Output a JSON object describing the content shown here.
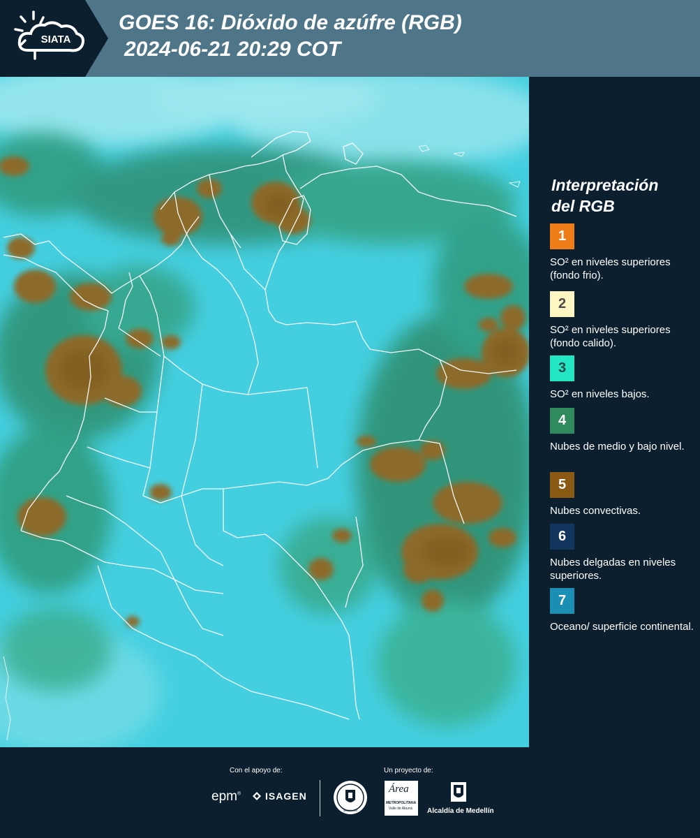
{
  "header": {
    "logo_text": "SIATA",
    "title_line1": "GOES 16: Dióxido de azúfre (RGB)",
    "title_line2": "2024-06-21 20:29 COT"
  },
  "map": {
    "base_color": "#3ec8dc",
    "convective_color": "#8a6a2a",
    "low_cloud_color": "#2f8a66",
    "border_color": "#ffffff"
  },
  "legend": {
    "title_line1": "Interpretación",
    "title_line2": "del RGB",
    "items": [
      {
        "num": "1",
        "color": "#ef7d1a",
        "text": "SO² en niveles superiores (fondo frio)."
      },
      {
        "num": "2",
        "color": "#fdf6c3",
        "text": "SO² en niveles superiores (fondo calido)."
      },
      {
        "num": "3",
        "color": "#23e6c4",
        "text": "SO² en niveles bajos."
      },
      {
        "num": "4",
        "color": "#2f8a5e",
        "text": "Nubes de medio y bajo nivel."
      },
      {
        "num": "5",
        "color": "#8a5a14",
        "text": "Nubes convectivas."
      },
      {
        "num": "6",
        "color": "#12355e",
        "text": "Nubes delgadas en niveles superiores."
      },
      {
        "num": "7",
        "color": "#1a8fb3",
        "text": "Oceano/ superficie continental."
      }
    ]
  },
  "footer": {
    "support_label": "Con el apoyo de:",
    "project_label": "Un proyecto de:",
    "sponsor1": "epm",
    "sponsor2": "ISAGEN",
    "partner1": "MEDELLÍN",
    "partner2_name": "Área",
    "partner2_sub1": "METROPOLITANA",
    "partner2_sub2": "Valle de Aburrá",
    "partner3": "Alcaldía de Medellín"
  }
}
